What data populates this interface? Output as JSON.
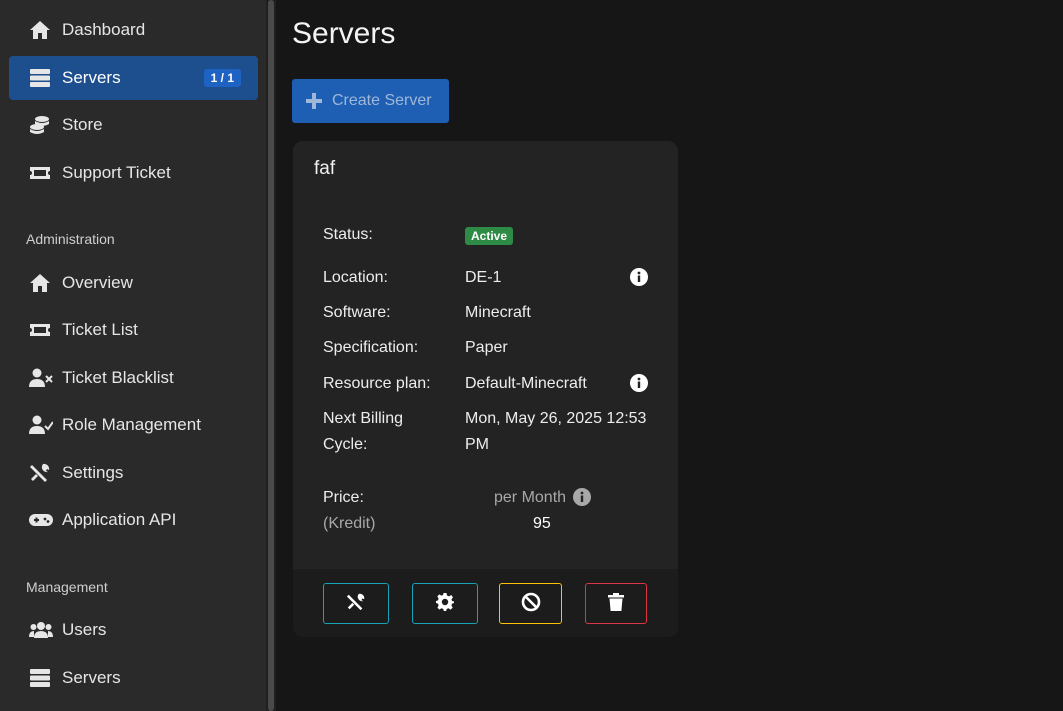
{
  "sidebar": {
    "items": [
      {
        "label": "Dashboard",
        "icon": "home-icon"
      },
      {
        "label": "Servers",
        "icon": "server-icon",
        "badge": "1 / 1",
        "active": true
      },
      {
        "label": "Store",
        "icon": "coins-icon"
      },
      {
        "label": "Support Ticket",
        "icon": "ticket-icon"
      }
    ],
    "administration": {
      "header": "Administration",
      "items": [
        {
          "label": "Overview",
          "icon": "home-icon"
        },
        {
          "label": "Ticket List",
          "icon": "ticket-icon"
        },
        {
          "label": "Ticket Blacklist",
          "icon": "user-times-icon"
        },
        {
          "label": "Role Management",
          "icon": "user-check-icon"
        },
        {
          "label": "Settings",
          "icon": "tools-icon"
        },
        {
          "label": "Application API",
          "icon": "gamepad-icon"
        }
      ]
    },
    "management": {
      "header": "Management",
      "items": [
        {
          "label": "Users",
          "icon": "users-icon"
        },
        {
          "label": "Servers",
          "icon": "server-icon"
        }
      ]
    }
  },
  "main": {
    "title": "Servers",
    "create_button": "Create Server"
  },
  "server_card": {
    "name": "faf",
    "status_label": "Status:",
    "status": "Active",
    "location_label": "Location:",
    "location": "DE-1",
    "software_label": "Software:",
    "software": "Minecraft",
    "specification_label": "Specification:",
    "specification": "Paper",
    "resource_plan_label": "Resource plan:",
    "resource_plan": "Default-Minecraft",
    "billing_label_line1": "Next Billing",
    "billing_label_line2": "Cycle:",
    "billing_line1": "Mon, May 26, 2025 12:53",
    "billing_line2": "PM",
    "price_label": "Price:",
    "price_unit": "(Kredit)",
    "price_period": "per Month",
    "price_value": "95",
    "actions": [
      {
        "name": "manage",
        "icon": "tools-icon",
        "color": "#17a2b8"
      },
      {
        "name": "settings",
        "icon": "gear-icon",
        "color": "#17a2b8"
      },
      {
        "name": "suspend",
        "icon": "ban-icon",
        "color": "#ffc107"
      },
      {
        "name": "delete",
        "icon": "trash-icon",
        "color": "#dc3545"
      }
    ]
  },
  "colors": {
    "accent": "#1d4f8f",
    "status_active": "#2e8b46",
    "info_btn": "#17a2b8",
    "warning_btn": "#ffc107",
    "danger_btn": "#dc3545"
  }
}
